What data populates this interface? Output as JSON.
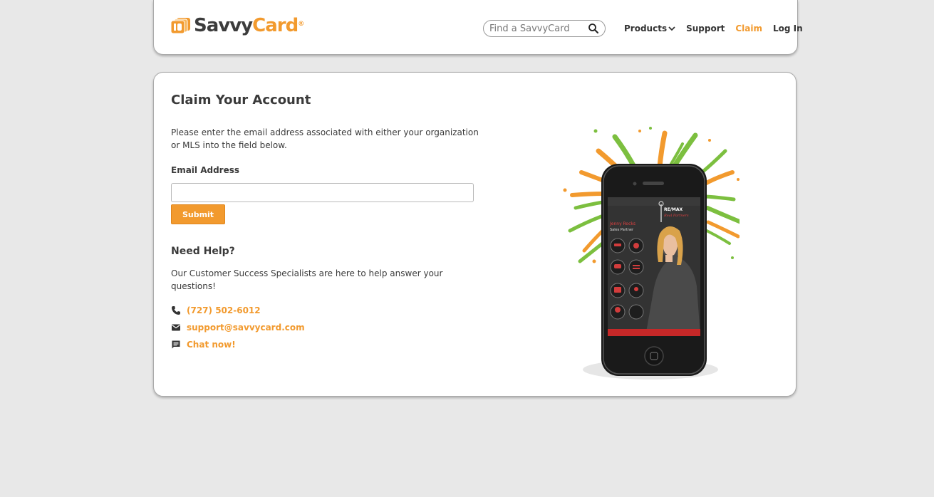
{
  "header": {
    "logo": {
      "name_part1": "Savvy",
      "name_part2": "Card",
      "registered": "®"
    },
    "search": {
      "placeholder": "Find a SavvyCard",
      "value": ""
    },
    "nav": {
      "products": "Products",
      "support": "Support",
      "claim": "Claim",
      "login": "Log In"
    }
  },
  "main": {
    "title": "Claim Your Account",
    "intro": "Please enter the email address associated with either your organization or MLS into the field below.",
    "email_label": "Email Address",
    "email_value": "",
    "submit_label": "Submit",
    "help": {
      "title": "Need Help?",
      "text": "Our Customer Success Specialists are here to help answer your questions!",
      "phone": "(727) 502-6012",
      "email": "support@savvycard.com",
      "chat": "Chat now!"
    },
    "phone_card": {
      "person_name": "Jenny Rocks",
      "person_title": "Sales Partner",
      "brand": "RE/MAX",
      "brand_sub": "Real Partners"
    }
  },
  "colors": {
    "accent": "#f29a2e",
    "text": "#3a3a3a",
    "background": "#e8e8e8",
    "green": "#7cbf3f"
  }
}
